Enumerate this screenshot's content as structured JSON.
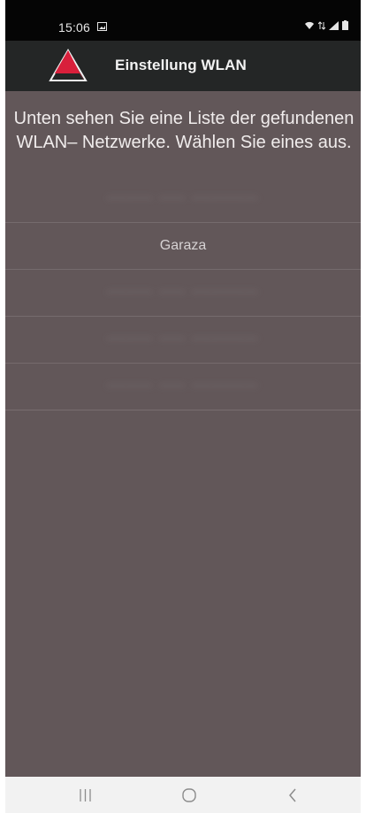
{
  "status_bar": {
    "time": "15:06",
    "left_icon": "image-icon",
    "right_icons": [
      "wifi-icon",
      "data-arrows-icon",
      "signal-icon",
      "battery-icon"
    ]
  },
  "app_bar": {
    "title": "Einstellung WLAN",
    "logo": "triangle-logo"
  },
  "main": {
    "intro_text": "Unten sehen Sie eine Liste der gefundenen WLAN– Netzwerke. Wählen Sie eines aus.",
    "networks": [
      {
        "label": "",
        "blurred": true
      },
      {
        "label": "Garaza",
        "blurred": false
      },
      {
        "label": "",
        "blurred": true
      },
      {
        "label": "",
        "blurred": true
      },
      {
        "label": "",
        "blurred": true
      }
    ]
  },
  "nav_bar": {
    "buttons": [
      "recents-icon",
      "home-icon",
      "back-icon"
    ]
  },
  "colors": {
    "status_bar_bg": "#050505",
    "app_bar_bg": "#242626",
    "content_bg": "#625759",
    "logo_red": "#d81f3b",
    "nav_bar_bg": "#f2f2f2"
  }
}
